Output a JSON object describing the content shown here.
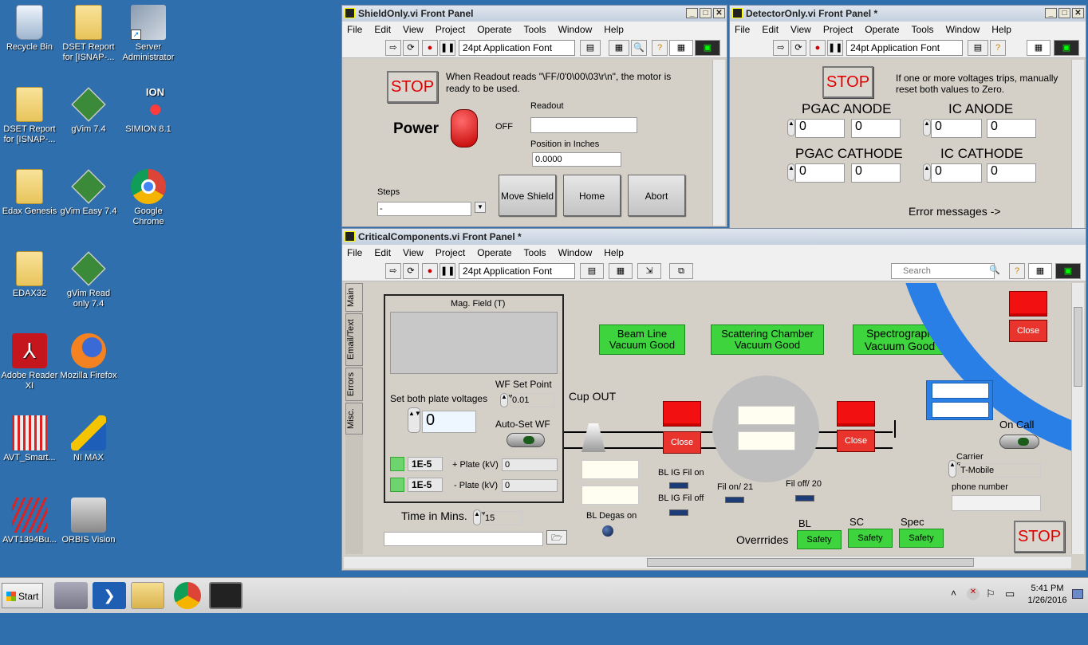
{
  "desktop": {
    "icons": [
      {
        "label": "Recycle Bin"
      },
      {
        "label": "DSET Report for [ISNAP-..."
      },
      {
        "label": "Server Administrator"
      },
      {
        "label": "DSET Report for [ISNAP-..."
      },
      {
        "label": "gVim 7.4"
      },
      {
        "label": "SIMION 8.1"
      },
      {
        "label": "Edax Genesis"
      },
      {
        "label": "gVim Easy 7.4"
      },
      {
        "label": "Google Chrome"
      },
      {
        "label": "EDAX32"
      },
      {
        "label": "gVim Read only 7.4"
      },
      {
        "label": "Adobe Reader XI"
      },
      {
        "label": "Mozilla Firefox"
      },
      {
        "label": "AVT_Smart..."
      },
      {
        "label": "NI MAX"
      },
      {
        "label": "AVT1394Bu..."
      },
      {
        "label": "ORBIS Vision"
      }
    ]
  },
  "menu": [
    "File",
    "Edit",
    "View",
    "Project",
    "Operate",
    "Tools",
    "Window",
    "Help"
  ],
  "font_selector": "24pt Application Font",
  "shield": {
    "title": "ShieldOnly.vi Front Panel",
    "stop": "STOP",
    "note": "When Readout reads \"\\FF/0'0\\00\\03\\r\\n\", the motor is ready to be used.",
    "power_label": "Power",
    "power_state": "OFF",
    "readout_label": "Readout",
    "readout_value": "",
    "position_label": "Position in Inches",
    "position_value": "0.0000",
    "steps_label": "Steps",
    "steps_value": "-",
    "move_shield": "Move Shield",
    "home": "Home",
    "abort": "Abort"
  },
  "detector": {
    "title": "DetectorOnly.vi Front Panel *",
    "stop": "STOP",
    "note": "If one or more voltages trips, manually reset both values to Zero.",
    "pgac_anode": "PGAC ANODE",
    "ic_anode": "IC ANODE",
    "pgac_cathode": "PGAC CATHODE",
    "ic_cathode": "IC CATHODE",
    "zero": "0",
    "errors": "Error messages ->"
  },
  "critical": {
    "title": "CriticalComponents.vi Front Panel *",
    "search_placeholder": "Search",
    "tabs": [
      "Main",
      "Email/Text",
      "Errors",
      "Misc."
    ],
    "mag_field": "Mag. Field (T)",
    "set_plate": "Set both plate voltages",
    "set_plate_value": "0",
    "wf_setpoint": "WF Set Point",
    "wf_setpoint_value": "0.01",
    "auto_set_wf": "Auto-Set WF",
    "plate_plus_range": "1E-5",
    "plate_plus_label": "+ Plate (kV)",
    "plate_plus_value": "0",
    "plate_minus_range": "1E-5",
    "plate_minus_label": "- Plate (kV)",
    "plate_minus_value": "0",
    "time_label": "Time in Mins.",
    "time_value": "15",
    "path_value": "",
    "cup_out": "Cup OUT",
    "beam_line": "Beam Line Vacuum Good",
    "scattering": "Scattering Chamber Vacuum Good",
    "spectrograph": "Spectrograph Vacuum Good",
    "close": "Close",
    "bl_ig_fil_on": "BL IG Fil on",
    "bl_ig_fil_off": "BL IG Fil off",
    "fil_on": "Fil on/ 21",
    "fil_off": "Fil off/ 20",
    "bl_degas": "BL Degas on",
    "on_call": "On Call",
    "carrier_label": "Carrier",
    "carrier_value": "T-Mobile",
    "phone_label": "phone number",
    "phone_value": "",
    "overrides": "Overrrides",
    "bl": "BL",
    "sc": "SC",
    "spec": "Spec",
    "safety": "Safety",
    "stop": "STOP"
  },
  "taskbar": {
    "start": "Start",
    "time": "5:41 PM",
    "date": "1/26/2016"
  }
}
